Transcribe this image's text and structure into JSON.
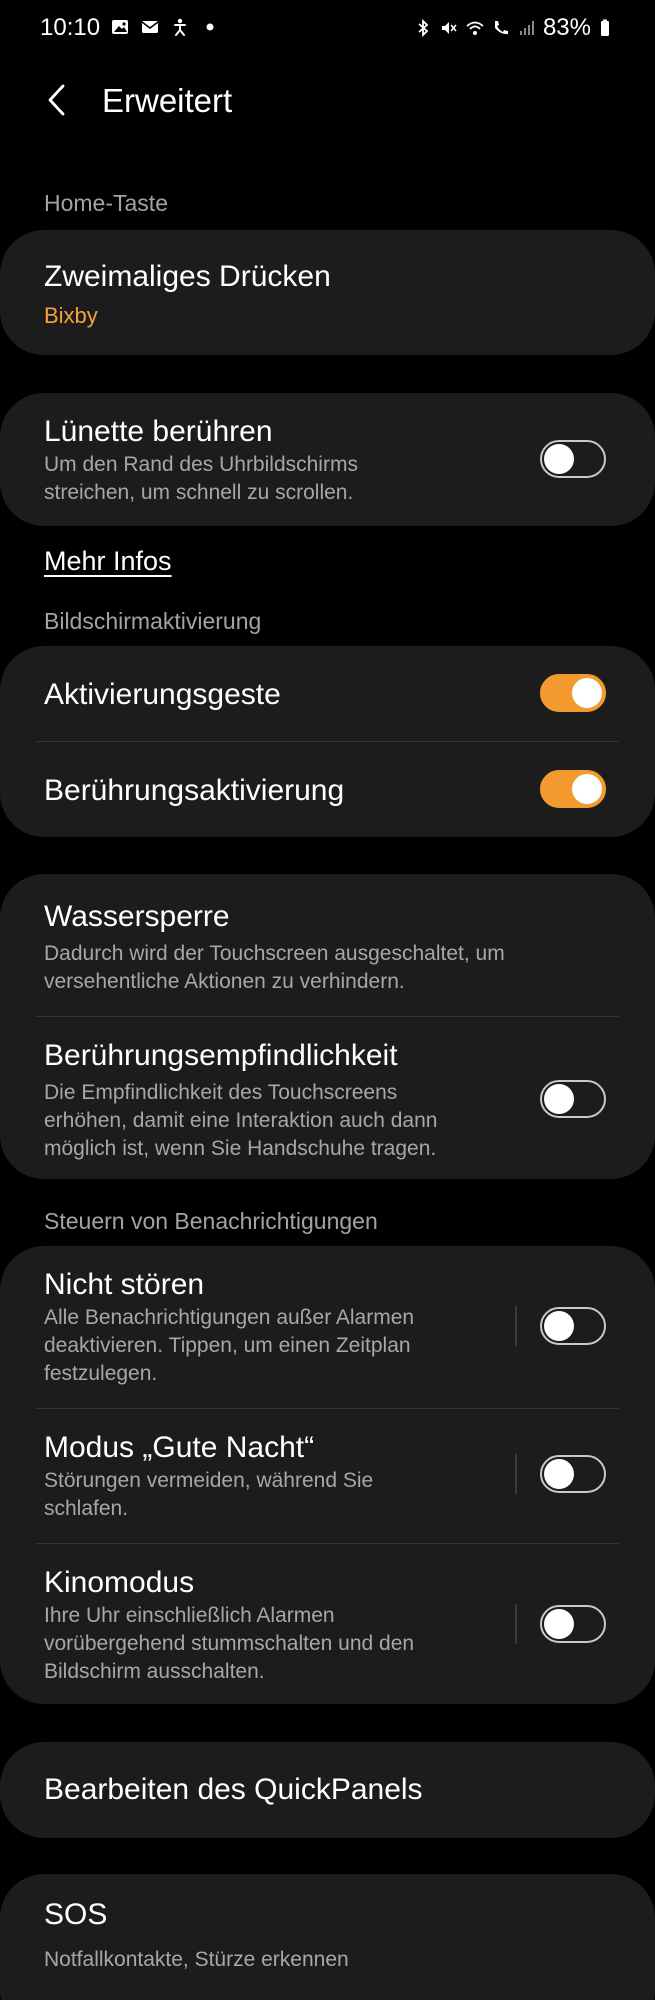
{
  "status_bar": {
    "time": "10:10",
    "battery": "83%",
    "icons_left": [
      "gallery-icon",
      "mail-icon",
      "accessibility-icon",
      "dot-icon"
    ],
    "icons_right": [
      "bluetooth-icon",
      "mute-icon",
      "wifi-icon",
      "wifi-calling-icon",
      "signal-icon",
      "battery-icon"
    ]
  },
  "header": {
    "title": "Erweitert"
  },
  "sections": {
    "home_key": "Home-Taste",
    "screen_wake": "Bildschirmaktivierung",
    "notifications": "Steuern von Benachrichtigungen"
  },
  "double_press": {
    "title": "Zweimaliges Drücken",
    "value": "Bixby"
  },
  "bezel": {
    "title": "Lünette berühren",
    "sub1": "Um den Rand des Uhrbildschirms",
    "sub2": "streichen, um schnell zu scrollen.",
    "on": false
  },
  "more_info": "Mehr Infos",
  "wake_gesture": {
    "title": "Aktivierungsgeste",
    "on": true
  },
  "touch_wake": {
    "title": "Berührungsaktivierung",
    "on": true
  },
  "water_lock": {
    "title": "Wassersperre",
    "sub1": "Dadurch wird der Touchscreen ausgeschaltet, um",
    "sub2": "versehentliche Aktionen zu verhindern."
  },
  "touch_sensitivity": {
    "title": "Berührungsempfindlichkeit",
    "sub1": "Die Empfindlichkeit des Touchscreens",
    "sub2": "erhöhen, damit eine Interaktion auch dann",
    "sub3": "möglich ist, wenn Sie Handschuhe tragen.",
    "on": false
  },
  "dnd": {
    "title": "Nicht stören",
    "sub1": "Alle Benachrichtigungen außer Alarmen",
    "sub2": "deaktivieren. Tippen, um einen Zeitplan",
    "sub3": "festzulegen.",
    "on": false
  },
  "good_night": {
    "title": "Modus „Gute Nacht“",
    "sub1": "Störungen vermeiden, während Sie",
    "sub2": "schlafen.",
    "on": false
  },
  "cinema": {
    "title": "Kinomodus",
    "sub1": "Ihre Uhr einschließlich Alarmen",
    "sub2": "vorübergehend stummschalten und den",
    "sub3": "Bildschirm ausschalten.",
    "on": false
  },
  "quickpanel": {
    "title": "Bearbeiten des QuickPanels"
  },
  "sos": {
    "title": "SOS",
    "sub1": "Notfallkontakte, Stürze erkennen"
  },
  "colors": {
    "accent": "#f39b2f",
    "card": "#1c1c1c",
    "background": "#000000"
  }
}
